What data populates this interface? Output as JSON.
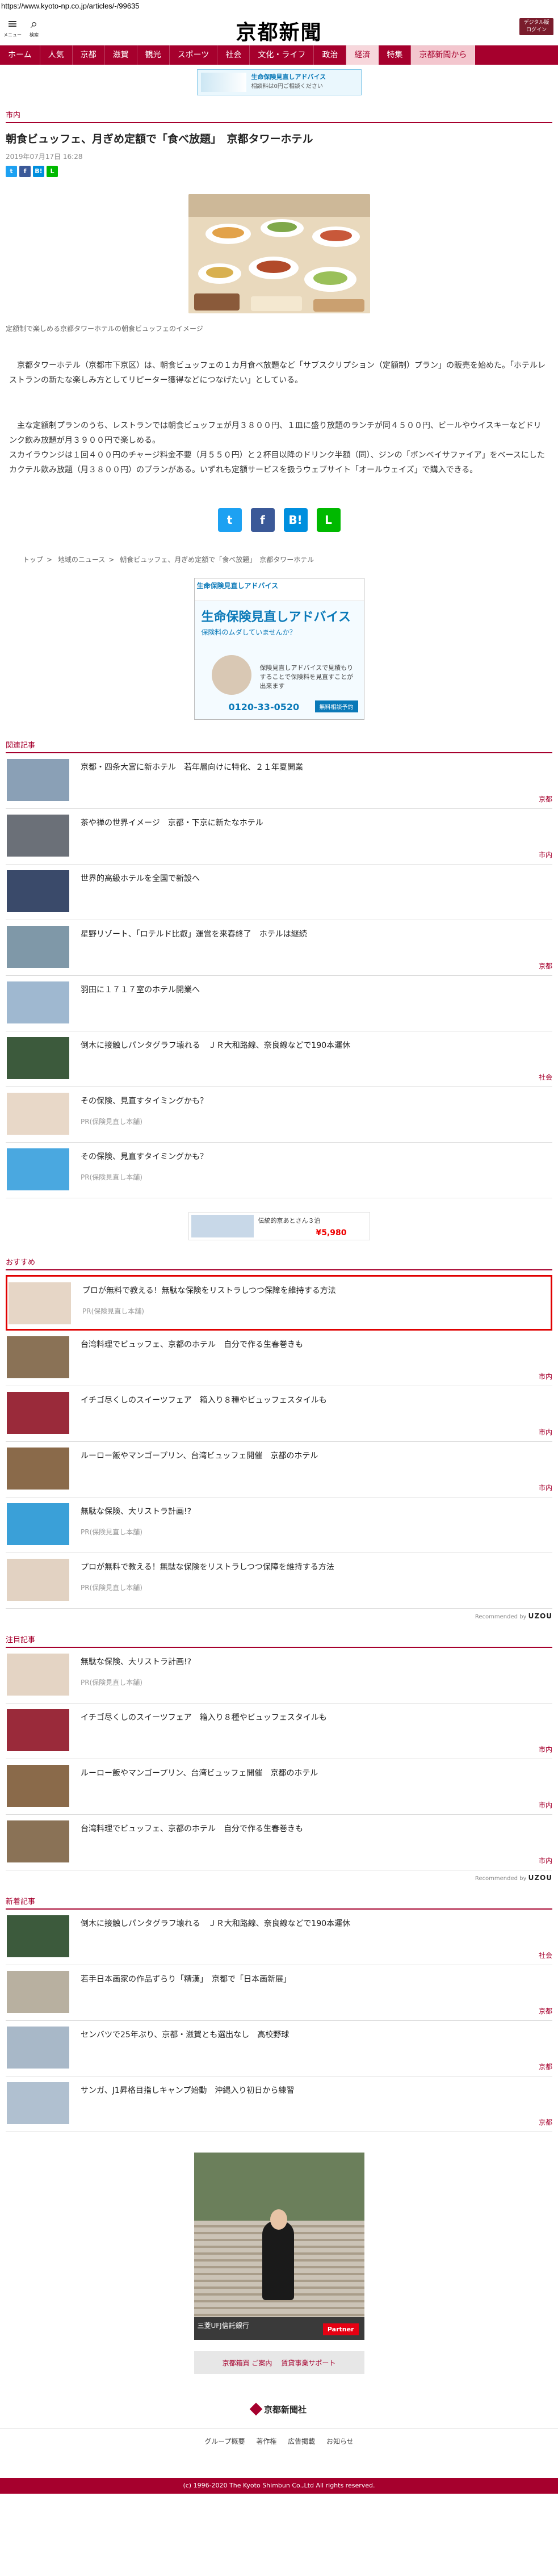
{
  "url": "https://www.kyoto-np.co.jp/articles/-/99635",
  "header": {
    "menu_label": "メニュー",
    "search_label": "検索",
    "logo": "京都新聞",
    "edition_label": "デジタル版\nログイン"
  },
  "nav": [
    "ホーム",
    "人気",
    "京都",
    "滋賀",
    "観光",
    "スポーツ",
    "社会",
    "文化・ライフ",
    "政治",
    "経済",
    "特集",
    "京都新聞から"
  ],
  "top_banner": {
    "title": "生命保険見直しアドバイス",
    "sub": "相談料は0円ご相談ください"
  },
  "article": {
    "category": "市内",
    "title": "朝食ビュッフェ、月ぎめ定額で「食べ放題」　京都タワーホテル",
    "date": "2019年07月17日 16:28",
    "caption": "定額制で楽しめる京都タワーホテルの朝食ビュッフェのイメージ",
    "paragraphs": [
      "京都タワーホテル（京都市下京区）は、朝食ビュッフェの１カ月食べ放題など「サブスクリプション（定額制）プラン」の販売を始めた。「ホテルレストランの新たな楽しみ方としてリピーター獲得などにつなげたい」としている。",
      "主な定額制プランのうち、レストランでは朝食ビュッフェが月３８００円、１皿に盛り放題のランチが同４５００円、ビールやウイスキーなどドリンク飲み放題が月３９００円で楽しめる。\nスカイラウンジは１回４００円のチャージ料金不要（月５５０円）と２杯目以降のドリンク半額（同）、ジンの「ボンベイサファイア」をベースにしたカクテル飲み放題（月３８００円）のプランがある。いずれも定額サービスを扱うウェブサイト「オールウェイズ」で購入できる。"
    ]
  },
  "breadcrumb": [
    "トップ",
    "地域のニュース",
    "朝食ビュッフェ、月ぎめ定額で「食べ放題」　京都タワーホテル"
  ],
  "square_ad": {
    "header": "生命保険見直しアドバイス",
    "title": "生命保険見直しアドバイス",
    "lead": "保険料のムダしていませんか？",
    "desc": "保険見直しアドバイスで見積もりすることで保険料を見直すことが出来ます",
    "phone": "0120-33-0520",
    "cta": "無料相談予約"
  },
  "related": {
    "heading": "関連記事",
    "items": [
      {
        "title": "京都・四条大宮に新ホテル　若年層向けに特化、２１年夏開業",
        "tag": "京都",
        "thumb": "#8aa0b6"
      },
      {
        "title": "茶や禅の世界イメージ　京都・下京に新たなホテル",
        "tag": "市内",
        "thumb": "#6b7078"
      },
      {
        "title": "世界的高級ホテルを全国で新設へ",
        "tag": "",
        "thumb": "#3a4a6a"
      },
      {
        "title": "星野リゾート、「ロテルド比叡」運営を来春終了　ホテルは継続",
        "tag": "京都",
        "thumb": "#7f98a8"
      },
      {
        "title": "羽田に１７１７室のホテル開業へ",
        "tag": "",
        "thumb": "#9fb8d0"
      },
      {
        "title": "倒木に接触しパンタグラフ壊れる　ＪＲ大和路線、奈良線などで190本運休",
        "tag": "社会",
        "thumb": "#3c5a3c"
      },
      {
        "title": "その保険、見直すタイミングかも？",
        "sub": "PR(保険見直し本舗)",
        "tag": "",
        "thumb": "#e8d8c8"
      },
      {
        "title": "その保険、見直すタイミングかも？",
        "sub": "PR(保険見直し本舗)",
        "tag": "",
        "thumb": "#4aa8e0"
      }
    ]
  },
  "small_ad": {
    "text": "伝統的京あとさん３泊",
    "price": "¥5,980"
  },
  "recommend": {
    "heading": "おすすめ",
    "items": [
      {
        "title": "プロが無料で教える！無駄な保険をリストラしつつ保障を維持する方法",
        "sub": "PR(保険見直し本舗)",
        "tag": "",
        "thumb": "#e6d6c6"
      },
      {
        "title": "台湾料理でビュッフェ、京都のホテル　自分で作る生春巻きも",
        "tag": "市内",
        "thumb": "#8a7256"
      },
      {
        "title": "イチゴ尽くしのスイーツフェア　箱入り８種やビュッフェスタイルも",
        "tag": "市内",
        "thumb": "#9a2a3a"
      },
      {
        "title": "ルーロー飯やマンゴープリン、台湾ビュッフェ開催　京都のホテル",
        "tag": "市内",
        "thumb": "#8a6a4a"
      },
      {
        "title": "無駄な保険、大リストラ計画!?",
        "sub": "PR(保険見直し本舗)",
        "tag": "",
        "thumb": "#3aa0d8"
      },
      {
        "title": "プロが無料で教える！無駄な保険をリストラしつつ保障を維持する方法",
        "sub": "PR(保険見直し本舗)",
        "tag": "",
        "thumb": "#e2d2c2"
      }
    ],
    "recommended_by": "Recommended by",
    "provider": "UZOU"
  },
  "notable": {
    "heading": "注目記事",
    "items": [
      {
        "title": "無駄な保険、大リストラ計画!?",
        "sub": "PR(保険見直し本舗)",
        "tag": "",
        "thumb": "#e4d4c4"
      },
      {
        "title": "イチゴ尽くしのスイーツフェア　箱入り８種やビュッフェスタイルも",
        "tag": "市内",
        "thumb": "#9a2a3a"
      },
      {
        "title": "ルーロー飯やマンゴープリン、台湾ビュッフェ開催　京都のホテル",
        "tag": "市内",
        "thumb": "#8a6a4a"
      },
      {
        "title": "台湾料理でビュッフェ、京都のホテル　自分で作る生春巻きも",
        "tag": "市内",
        "thumb": "#8a7256"
      }
    ],
    "recommended_by": "Recommended by",
    "provider": "UZOU"
  },
  "latest": {
    "heading": "新着記事",
    "items": [
      {
        "title": "倒木に接触しパンタグラフ壊れる　ＪＲ大和路線、奈良線などで190本運休",
        "tag": "社会",
        "thumb": "#3c5a3c"
      },
      {
        "title": "若手日本画家の作品ずらり「精漢」　京都で「日本画新展」",
        "tag": "京都",
        "thumb": "#b8b0a0"
      },
      {
        "title": "センバツで25年ぶり、京都・滋賀とも選出なし　高校野球",
        "tag": "京都",
        "thumb": "#a8b8c8"
      },
      {
        "title": "サンガ、J1昇格目指しキャンプ始動　沖縄入り初日から練習",
        "tag": "京都",
        "thumb": "#b0c0d0"
      }
    ]
  },
  "tall_ad": {
    "bar_text": "三菱UFJ信託銀行",
    "partner": "Partner"
  },
  "gray_buttons": [
    "京都箱買 ご案内",
    "賃貸事業サポート"
  ],
  "footer": {
    "logo": "京都新聞社",
    "links": [
      "グループ概要",
      "著作権",
      "広告掲載",
      "お知らせ"
    ],
    "copyright": "(c) 1996-2020 The Kyoto Shimbun Co.,Ltd All rights reserved."
  }
}
